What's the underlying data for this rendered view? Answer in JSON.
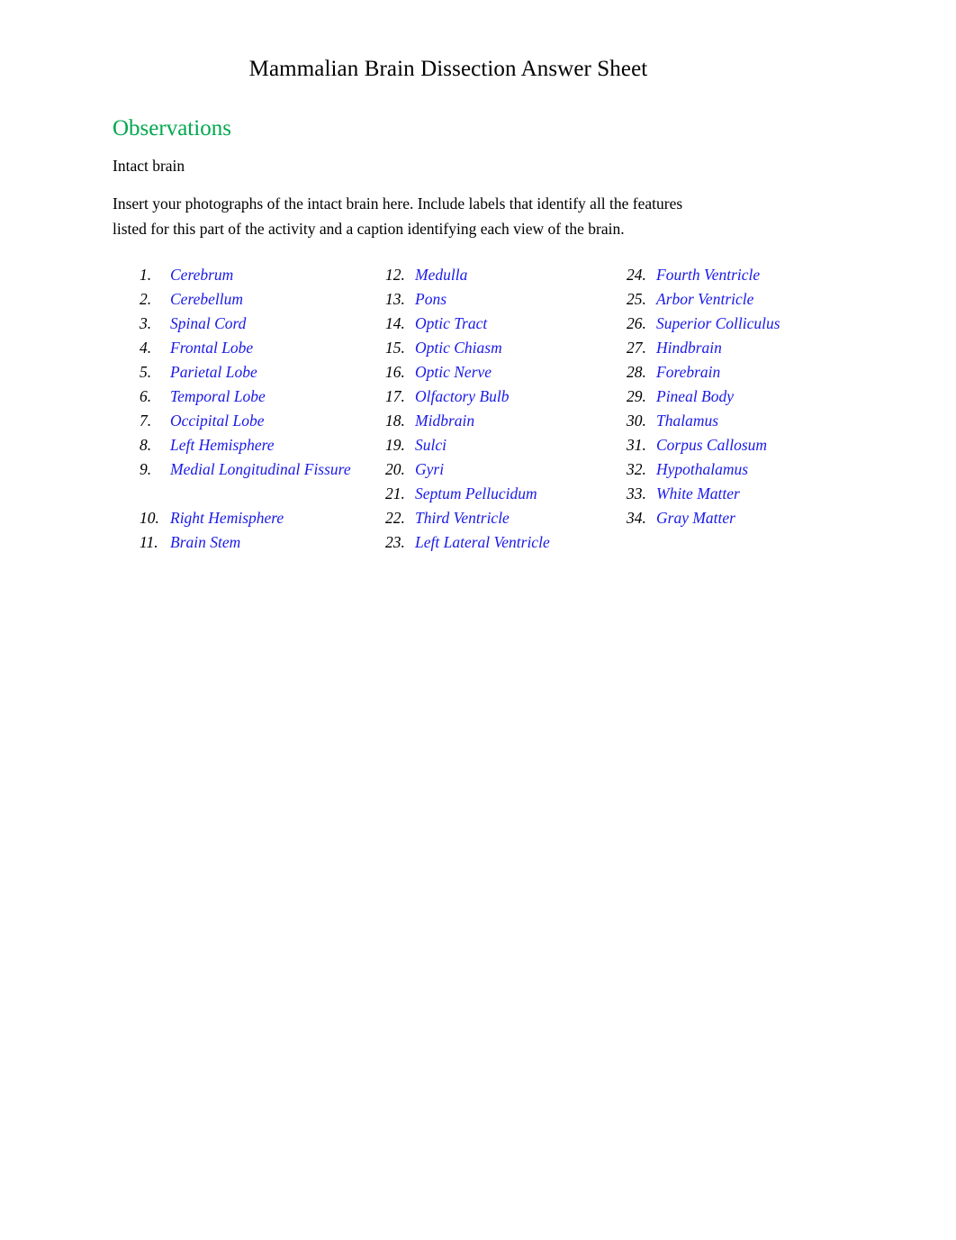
{
  "document": {
    "title": "Mammalian Brain Dissection Answer Sheet"
  },
  "section": {
    "heading": "Observations",
    "heading_color": "#00a84e",
    "subheading": "Intact brain",
    "instructions": "Insert your photographs of the intact brain here. Include labels that identify all the features listed for this part of the activity and a caption identifying each view of the brain."
  },
  "features_list": {
    "item_color": "#1a1ae8",
    "columns": [
      {
        "items": [
          {
            "number": "1.",
            "label": "Cerebrum"
          },
          {
            "number": "2.",
            "label": "Cerebellum"
          },
          {
            "number": "3.",
            "label": "Spinal Cord"
          },
          {
            "number": "4.",
            "label": "Frontal Lobe"
          },
          {
            "number": "5.",
            "label": "Parietal Lobe"
          },
          {
            "number": "6.",
            "label": "Temporal Lobe"
          },
          {
            "number": "7.",
            "label": "Occipital Lobe"
          },
          {
            "number": "8.",
            "label": "Left Hemisphere"
          },
          {
            "number": "9.",
            "label": "Medial Longitudinal Fissure"
          },
          {
            "number": "10.",
            "label": "Right Hemisphere"
          },
          {
            "number": "11.",
            "label": "Brain Stem"
          }
        ]
      },
      {
        "items": [
          {
            "number": "12.",
            "label": "Medulla"
          },
          {
            "number": "13.",
            "label": "Pons"
          },
          {
            "number": "14.",
            "label": "Optic Tract"
          },
          {
            "number": "15.",
            "label": "Optic Chiasm"
          },
          {
            "number": "16.",
            "label": "Optic Nerve"
          },
          {
            "number": "17.",
            "label": "Olfactory Bulb"
          },
          {
            "number": "18.",
            "label": "Midbrain"
          },
          {
            "number": "19.",
            "label": "Sulci"
          },
          {
            "number": "20.",
            "label": "Gyri"
          },
          {
            "number": "21.",
            "label": "Septum Pellucidum"
          },
          {
            "number": "22.",
            "label": "Third Ventricle"
          },
          {
            "number": "23.",
            "label": "Left Lateral Ventricle"
          }
        ]
      },
      {
        "items": [
          {
            "number": "24.",
            "label": "Fourth Ventricle"
          },
          {
            "number": "25.",
            "label": "Arbor Ventricle"
          },
          {
            "number": "26.",
            "label": "Superior Colliculus"
          },
          {
            "number": "27.",
            "label": "Hindbrain"
          },
          {
            "number": "28.",
            "label": "Forebrain"
          },
          {
            "number": "29.",
            "label": "Pineal Body"
          },
          {
            "number": "30.",
            "label": "Thalamus"
          },
          {
            "number": "31.",
            "label": "Corpus Callosum"
          },
          {
            "number": "32.",
            "label": "Hypothalamus"
          },
          {
            "number": "33.",
            "label": "White Matter"
          },
          {
            "number": "34.",
            "label": "Gray Matter"
          }
        ]
      }
    ]
  }
}
